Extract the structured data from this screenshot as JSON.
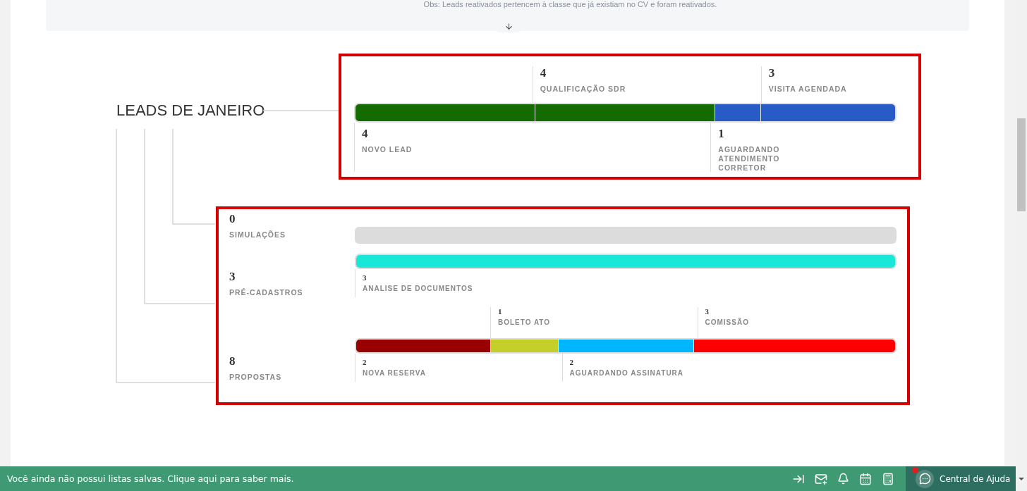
{
  "notice": {
    "text": "Obs: Leads reativados pertencem à classe que já existiam no CV e foram reativados."
  },
  "title": "LEADS DE JANEIRO",
  "leads_funnel": {
    "stages": [
      {
        "value": "4",
        "label": "NOVO LEAD",
        "color": "#146c00"
      },
      {
        "value": "4",
        "label": "QUALIFICAÇÃO SDR",
        "color": "#146c00"
      },
      {
        "value": "1",
        "label": "AGUARDANDO ATENDIMENTO CORRETOR",
        "color": "#285bc5"
      },
      {
        "value": "3",
        "label": "VISITA AGENDADA",
        "color": "#285bc5"
      }
    ]
  },
  "groups": [
    {
      "value": "0",
      "label": "SIMULAÇÕES"
    },
    {
      "value": "3",
      "label": "PRÉ-CADASTROS",
      "stages": [
        {
          "value": "3",
          "label": "ANALISE DE DOCUMENTOS",
          "color": "#19e8d8"
        }
      ]
    },
    {
      "value": "8",
      "label": "PROPOSTAS",
      "stages": [
        {
          "value": "2",
          "label": "NOVA RESERVA",
          "color": "#990000"
        },
        {
          "value": "1",
          "label": "BOLETO ATO",
          "color": "#c4cf2a"
        },
        {
          "value": "2",
          "label": "AGUARDANDO ASSINATURA",
          "color": "#00b6ff"
        },
        {
          "value": "3",
          "label": "COMISSÃO",
          "color": "#ff0000"
        }
      ]
    }
  ],
  "footer": {
    "message": "Você ainda não possui listas salvas. Clique aqui para saber mais.",
    "help_label": "Central de Ajuda",
    "help_alert": true
  }
}
